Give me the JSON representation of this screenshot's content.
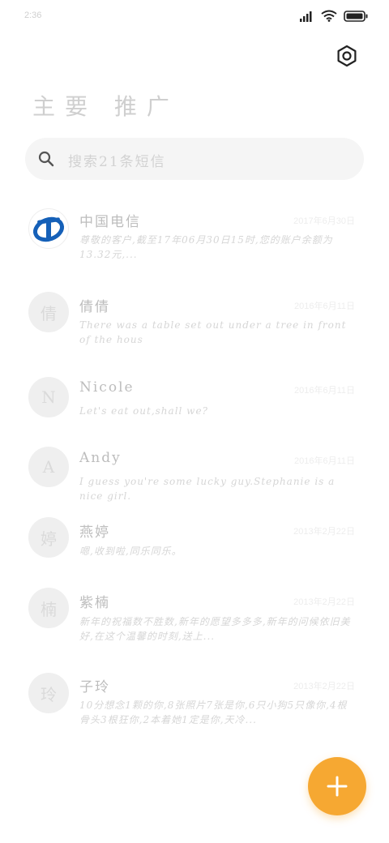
{
  "status_bar": {
    "time": "2:36"
  },
  "header": {
    "title": "主要 推广"
  },
  "search": {
    "placeholder": "搜索21条短信"
  },
  "conversations": [
    {
      "name": "中国电信",
      "date": "2017年6月30日",
      "preview": "尊敬的客户,截至17年06月30日15时,您的账户余额为13.32元,...",
      "avatar": "china-telecom-logo"
    },
    {
      "name": "倩倩",
      "date": "2016年6月11日",
      "preview": "There was a table set out under a tree in front of the hous",
      "avatar_letter": "倩"
    },
    {
      "name": "Nicole",
      "date": "2016年6月11日",
      "preview": "Let's eat out,shall we?",
      "avatar_letter": "N"
    },
    {
      "name": "Andy",
      "date": "2016年6月11日",
      "preview": "I guess you're some lucky guy.Stephanie is a nice girl.",
      "avatar_letter": "A"
    },
    {
      "name": "燕婷",
      "date": "2013年2月22日",
      "preview": "嗯,收到啦,同乐同乐。",
      "avatar_letter": "婷"
    },
    {
      "name": "紫楠",
      "date": "2013年2月22日",
      "preview": "新年的祝福数不胜数,新年的愿望多多多,新年的问候依旧美好,在这个温馨的时刻,送上...",
      "avatar_letter": "楠"
    },
    {
      "name": "子玲",
      "date": "2013年2月22日",
      "preview": "10分想念1颗的你,8张照片7张是你,6只小狗5只像你,4根骨头3根狂你,2本着她1定是你,天冷...",
      "avatar_letter": "玲"
    }
  ],
  "colors": {
    "accent": "#f6a832",
    "telecom_blue": "#1560b8"
  },
  "icons": [
    "signal-icon",
    "wifi-icon",
    "battery-icon",
    "settings-icon",
    "search-icon",
    "plus-icon"
  ]
}
